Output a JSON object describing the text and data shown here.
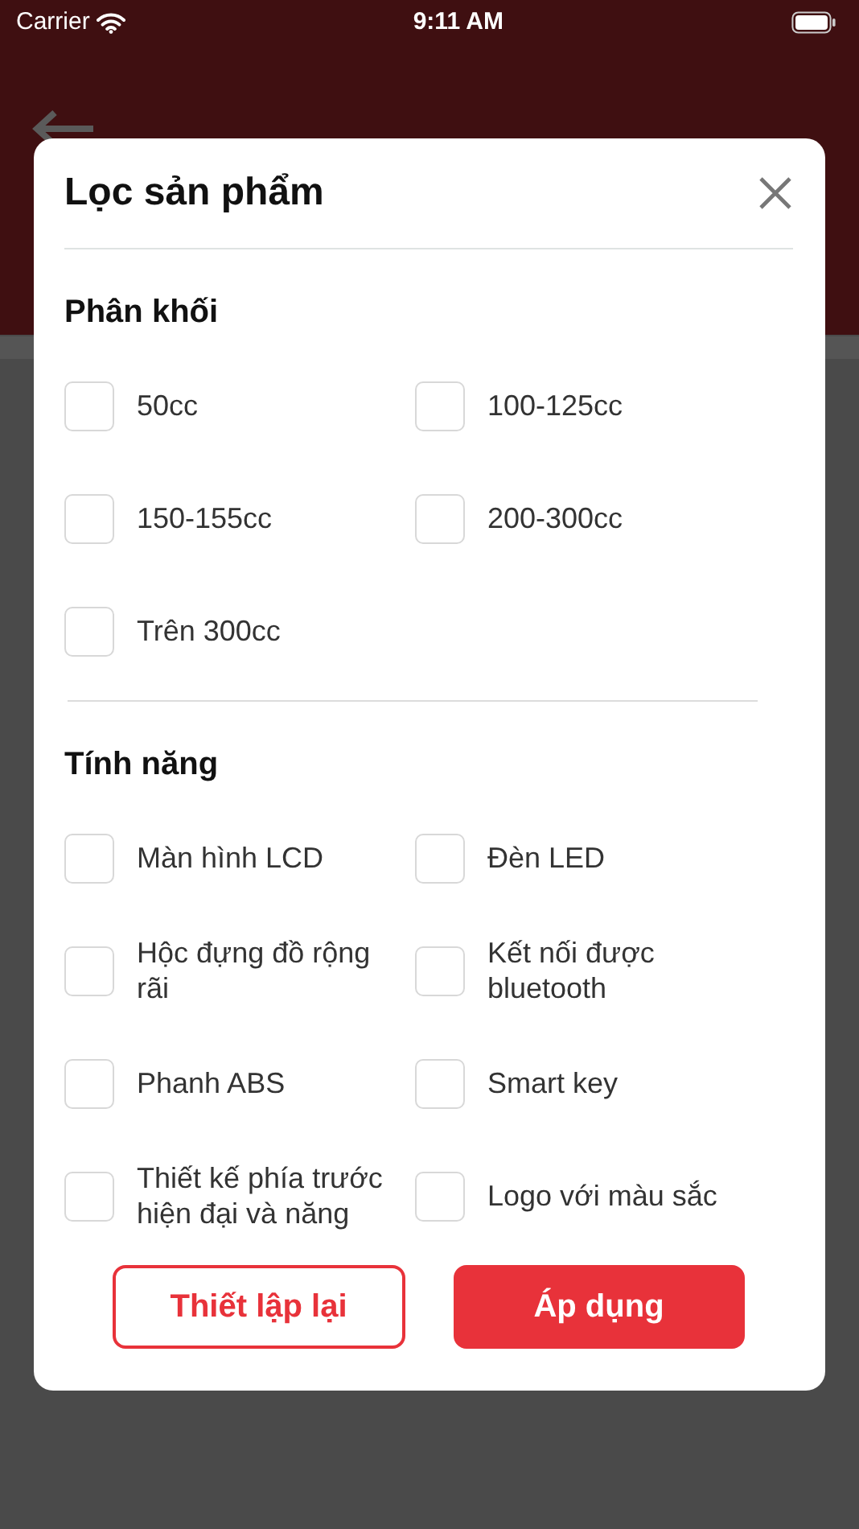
{
  "status_bar": {
    "carrier": "Carrier",
    "time": "9:11 AM"
  },
  "filter_dialog": {
    "title": "Lọc sản phẩm",
    "sections": [
      {
        "title": "Phân khối",
        "options": [
          {
            "label": "50cc",
            "checked": false
          },
          {
            "label": "100-125cc",
            "checked": false
          },
          {
            "label": "150-155cc",
            "checked": false
          },
          {
            "label": "200-300cc",
            "checked": false
          },
          {
            "label": "Trên 300cc",
            "checked": false
          }
        ]
      },
      {
        "title": "Tính năng",
        "options": [
          {
            "label": "Màn hình LCD",
            "checked": false
          },
          {
            "label": "Đèn LED",
            "checked": false
          },
          {
            "label": "Hộc đựng đồ rộng rãi",
            "checked": false
          },
          {
            "label": "Kết nối được bluetooth",
            "checked": false
          },
          {
            "label": "Phanh ABS",
            "checked": false
          },
          {
            "label": "Smart key",
            "checked": false
          },
          {
            "label": "Thiết kế phía trước hiện đại và năng",
            "checked": false
          },
          {
            "label": "Logo với màu sắc",
            "checked": false
          }
        ]
      }
    ],
    "buttons": [
      {
        "label": "Thiết lập lại",
        "kind": "outline"
      },
      {
        "label": "Áp dụng",
        "kind": "solid"
      }
    ]
  }
}
